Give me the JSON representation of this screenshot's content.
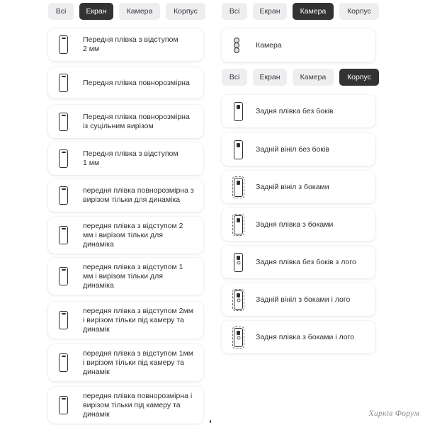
{
  "left_panel": {
    "tabs": [
      {
        "label": "Всі",
        "active": false
      },
      {
        "label": "Екран",
        "active": true
      },
      {
        "label": "Камера",
        "active": false
      },
      {
        "label": "Корпус",
        "active": false
      }
    ],
    "items": [
      {
        "label": "Передня плівка з відступом\n2 мм",
        "icon": "phone-front-icon"
      },
      {
        "label": "Передня плівка повнорозмірна",
        "icon": "phone-front-icon"
      },
      {
        "label": "Передня плівка повнорозмірна\nіз суцільним вирізом",
        "icon": "phone-front-icon"
      },
      {
        "label": "Передня плівка з відступом\n1 мм",
        "icon": "phone-front-icon"
      },
      {
        "label": "передня плівка повнорозмірна з\nвирізом тільки для динаміка",
        "icon": "phone-front-icon"
      },
      {
        "label": "передня плівка з відступом 2\nмм і вирізом тільки для\nдинаміка",
        "icon": "phone-front-icon"
      },
      {
        "label": "передня плівка з відступом 1\nмм і вирізом тільки для\nдинаміка",
        "icon": "phone-front-icon"
      },
      {
        "label": "передня плівка з відступом 2мм\nі вирізом тільки під камеру та\nдинамік",
        "icon": "phone-front-icon"
      },
      {
        "label": "передня плівка з відступом 1мм\nі вирізом тільки під камеру та\nдинамік",
        "icon": "phone-front-icon"
      },
      {
        "label": "передня плівка повнорозмірна і\nвирізом тільки під камеру та\nдинамік",
        "icon": "phone-front-icon"
      }
    ]
  },
  "right_panel": {
    "tabs_top": [
      {
        "label": "Всі",
        "active": false
      },
      {
        "label": "Екран",
        "active": false
      },
      {
        "label": "Камера",
        "active": true
      },
      {
        "label": "Корпус",
        "active": false
      }
    ],
    "camera_item": {
      "label": "Камера",
      "icon": "camera-lenses-icon"
    },
    "tabs_bottom": [
      {
        "label": "Всі",
        "active": false
      },
      {
        "label": "Екран",
        "active": false
      },
      {
        "label": "Камера",
        "active": false
      },
      {
        "label": "Корпус",
        "active": true
      }
    ],
    "body_items": [
      {
        "label": "Задня плівка без боків",
        "icon": "phone-back-icon"
      },
      {
        "label": "Задній вініл без боків",
        "icon": "phone-back-icon"
      },
      {
        "label": "Задній вініл з боками",
        "icon": "phone-back-sides-icon"
      },
      {
        "label": "Задня плівка з боками",
        "icon": "phone-back-sides-icon"
      },
      {
        "label": "Задня плівка без боків з лого",
        "icon": "phone-back-logo-icon"
      },
      {
        "label": "Задній вініл з боками і лого",
        "icon": "phone-back-sides-logo-icon"
      },
      {
        "label": "Задня плівка з боками і лого",
        "icon": "phone-back-sides-logo-icon"
      }
    ]
  },
  "watermark": "Харків Форум",
  "colors": {
    "tab_bg": "#eeeef1",
    "tab_active_bg": "#333333",
    "tab_active_text": "#ffffff",
    "card_bg": "#ffffff"
  }
}
